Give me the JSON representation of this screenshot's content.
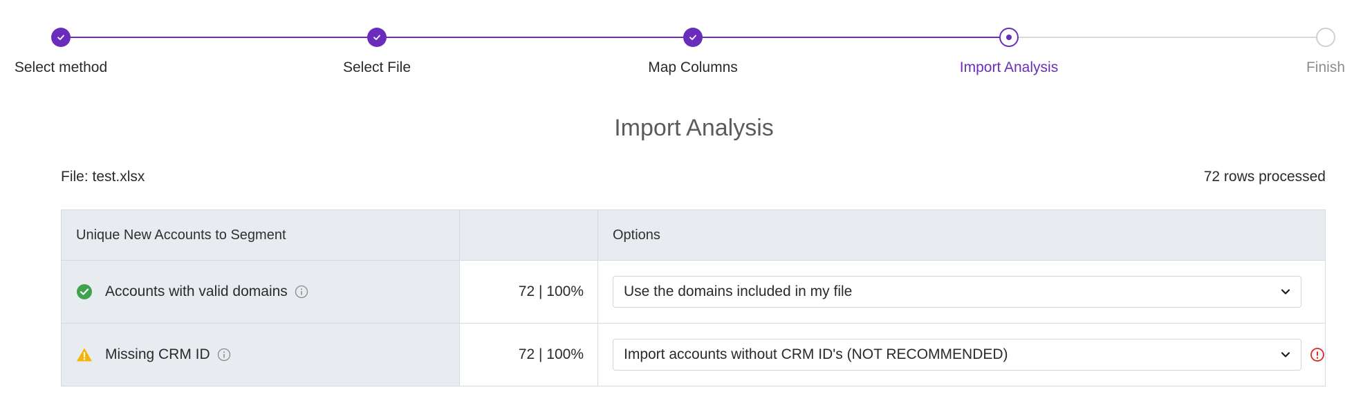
{
  "stepper": {
    "steps": [
      {
        "label": "Select method",
        "state": "done"
      },
      {
        "label": "Select File",
        "state": "done"
      },
      {
        "label": "Map Columns",
        "state": "done"
      },
      {
        "label": "Import Analysis",
        "state": "current"
      },
      {
        "label": "Finish",
        "state": "todo"
      }
    ]
  },
  "page": {
    "title": "Import Analysis",
    "file_label": "File: test.xlsx",
    "rows_processed": "72 rows processed"
  },
  "table": {
    "headers": [
      "Unique New Accounts to Segment",
      "",
      "Options"
    ],
    "rows": [
      {
        "label": "Accounts with valid domains",
        "status_icon": "check-circle-icon",
        "value": "72 | 100%",
        "option": "Use the domains included in my file",
        "alert": false
      },
      {
        "label": "Missing CRM ID",
        "status_icon": "warning-triangle-icon",
        "value": "72 | 100%",
        "option": "Import accounts without CRM ID's (NOT RECOMMENDED)",
        "alert": true
      }
    ]
  },
  "colors": {
    "accent": "#6a2dbb",
    "success": "#3fa34d",
    "warning": "#f4b400",
    "danger": "#e02424"
  }
}
